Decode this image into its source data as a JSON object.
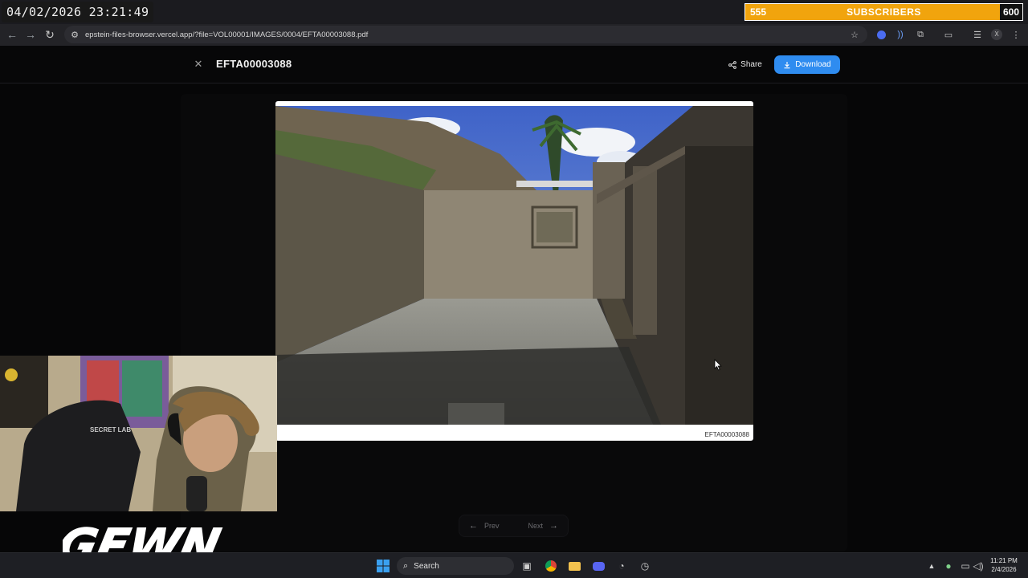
{
  "overlay": {
    "datetime": "04/02/2026 23:21:49",
    "sub_goal": {
      "current": "555",
      "label": "SUBSCRIBERS",
      "target": "600",
      "progress_fraction": 0.925,
      "color": "#f1a40d"
    }
  },
  "browser": {
    "url": "epstein-files-browser.vercel.app/?file=VOL00001/IMAGES/0004/EFTA00003088.pdf",
    "profile_initial": "X"
  },
  "viewer": {
    "title": "EFTA00003088",
    "share_label": "Share",
    "download_label": "Download",
    "page_id": "EFTA00003088",
    "prev_label": "Prev",
    "next_label": "Next",
    "accent": "#2f8cf0"
  },
  "stream": {
    "logo_text": "GEWN",
    "chair_text": "SECRET LAB"
  },
  "taskbar": {
    "search_label": "Search",
    "time": "11:21 PM",
    "date": "2/4/2026"
  },
  "icons": {
    "back": "arrow-left-icon",
    "forward": "arrow-right-icon",
    "reload": "reload-icon",
    "star": "star-icon",
    "extensions": "puzzle-icon",
    "menu": "kebab-icon",
    "close": "close-icon",
    "share": "share-icon",
    "download": "download-icon"
  }
}
